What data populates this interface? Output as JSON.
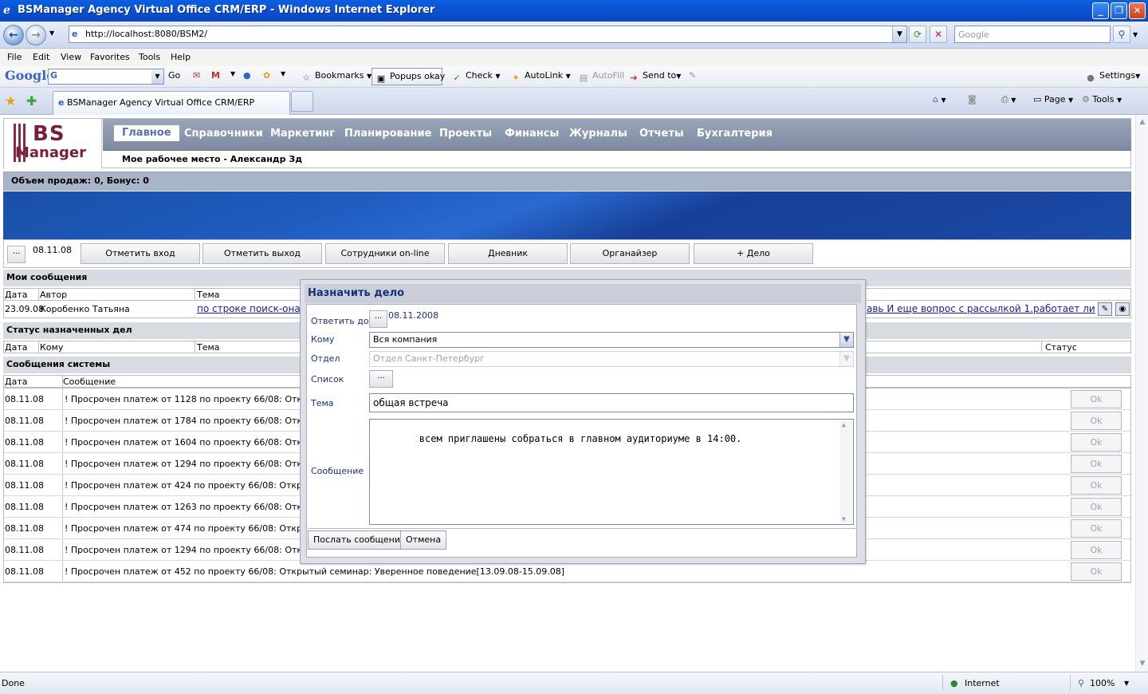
{
  "window": {
    "title": "BSManager Agency Virtual Office CRM/ERP - Windows Internet Explorer",
    "minimize": "_",
    "maximize": "❐",
    "close": "✕"
  },
  "address": {
    "url": "http://localhost:8080/BSM2/",
    "search_placeholder": "Google"
  },
  "menu": [
    "File",
    "Edit",
    "View",
    "Favorites",
    "Tools",
    "Help"
  ],
  "google_toolbar": {
    "logo": "Google",
    "go": "Go",
    "bookmarks": "Bookmarks",
    "popups": "Popups okay",
    "check": "Check",
    "autolink": "AutoLink",
    "autofill": "AutoFill",
    "sendto": "Send to",
    "settings": "Settings"
  },
  "tabs": {
    "active_tab": "BSManager Agency Virtual Office CRM/ERP",
    "page": "Page",
    "tools": "Tools"
  },
  "status": {
    "text": "Done",
    "zone": "Internet",
    "zoom": "100%"
  },
  "app": {
    "logo_top": "BS",
    "logo_bottom": "Manager",
    "nav": [
      "Главное",
      "Справочники",
      "Маркетинг",
      "Планирование",
      "Проекты",
      "Финансы",
      "Журналы",
      "Отчеты",
      "Бухгалтерия"
    ],
    "workplace": "Мое рабочее место - Александр Зд",
    "sales": "Объем продаж: 0, Бонус: 0",
    "action_date": "08.11.08",
    "ellipsis": "...",
    "action_buttons": [
      "Отметить вход",
      "Отметить выход",
      "Сотрудники on-line",
      "Дневник",
      "Органайзер",
      "+ Дело"
    ]
  },
  "my_messages": {
    "title": "Мои сообщения",
    "columns": [
      "Дата",
      "Автор",
      "Тема"
    ],
    "row": {
      "date": "23.09.08",
      "author": "Коробенко Татьяна",
      "subject_left": "по строке поиск-она н",
      "subject_right": "авь И еще вопрос с рассылкой 1.работает ли"
    }
  },
  "assigned_status": {
    "title": "Статус назначенных дел",
    "columns": [
      "Дата",
      "Кому",
      "Тема",
      "Статус"
    ]
  },
  "system_messages": {
    "title": "Сообщения системы",
    "columns": [
      "Дата",
      "Сообщение"
    ],
    "ok_label": "Ok",
    "rows": [
      {
        "date": "08.11.08",
        "text": "! Просрочен платеж от 1128 по проекту 66/08: Открытый"
      },
      {
        "date": "08.11.08",
        "text": "! Просрочен платеж от 1784 по проекту 66/08: Открытый"
      },
      {
        "date": "08.11.08",
        "text": "! Просрочен платеж от 1604 по проекту 66/08: Открытый"
      },
      {
        "date": "08.11.08",
        "text": "! Просрочен платеж от 1294 по проекту 66/08: Открытый"
      },
      {
        "date": "08.11.08",
        "text": "! Просрочен платеж от 424 по проекту 66/08: Открытый се"
      },
      {
        "date": "08.11.08",
        "text": "! Просрочен платеж от 1263 по проекту 66/08: Открытый"
      },
      {
        "date": "08.11.08",
        "text": "! Просрочен платеж от 474 по проекту 66/08: Открытый се"
      },
      {
        "date": "08.11.08",
        "text": "! Просрочен платеж от 1294 по проекту 66/08: Открытый"
      },
      {
        "date": "08.11.08",
        "text": "! Просрочен платеж от 452 по проекту 66/08: Открытый семинар: Уверенное поведение[13.09.08-15.09.08]"
      }
    ]
  },
  "dialog": {
    "title": "Назначить дело",
    "reply_by_label": "Ответить до:",
    "reply_by_value": "08.11.2008",
    "to_label": "Кому",
    "to_value": "Вся компания",
    "dept_label": "Отдел",
    "dept_value": "Отдел Санкт-Петербург",
    "list_label": "Список",
    "subject_label": "Тема",
    "subject_value": "общая встреча",
    "message_label": "Сообщение",
    "message_value": "всем приглашены собраться в главном аудиториуме в 14:00.",
    "send_button": "Послать сообщение",
    "cancel_button": "Отмена"
  }
}
